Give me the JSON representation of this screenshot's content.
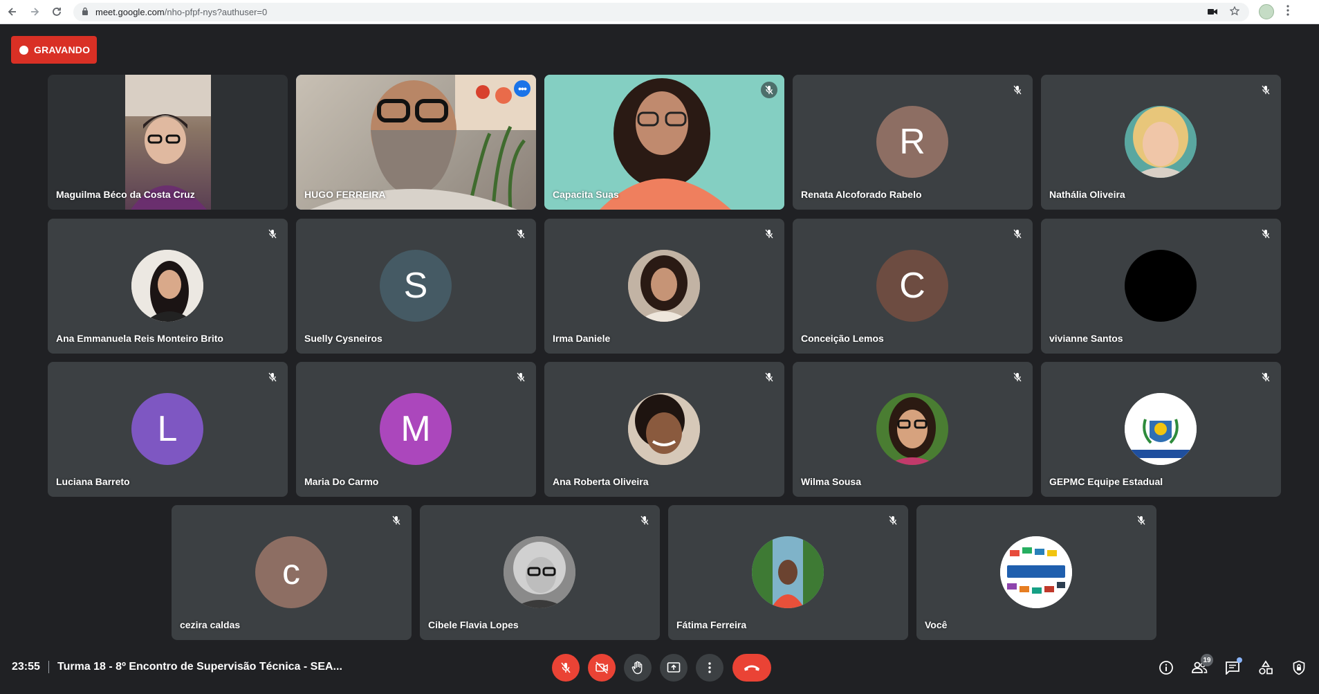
{
  "browser": {
    "url_host": "meet.google.com",
    "url_path": "/nho-pfpf-nys?authuser=0"
  },
  "recording": {
    "label": "GRAVANDO",
    "color": "#d93025"
  },
  "participants": [
    {
      "name": "Maguilma Béco da Costa Cruz",
      "type": "video"
    },
    {
      "name": "HUGO FERREIRA",
      "type": "video",
      "speaking": true
    },
    {
      "name": "Capacita Suas",
      "type": "video",
      "muted": true
    },
    {
      "name": "Renata Alcoforado Rabelo",
      "type": "initial",
      "initial": "R",
      "color": "#8d6e63",
      "muted": true
    },
    {
      "name": "Nathália Oliveira",
      "type": "photo",
      "muted": true
    },
    {
      "name": "Ana Emmanuela Reis Monteiro Brito",
      "type": "photo",
      "muted": true
    },
    {
      "name": "Suelly Cysneiros",
      "type": "initial",
      "initial": "S",
      "color": "#455a64",
      "muted": true
    },
    {
      "name": "Irma Daniele",
      "type": "photo",
      "muted": true
    },
    {
      "name": "Conceição Lemos",
      "type": "initial",
      "initial": "C",
      "color": "#6d4c41",
      "muted": true
    },
    {
      "name": "vivianne Santos",
      "type": "photo",
      "muted": true
    },
    {
      "name": "Luciana Barreto",
      "type": "initial",
      "initial": "L",
      "color": "#7e57c2",
      "muted": true
    },
    {
      "name": "Maria Do Carmo",
      "type": "initial",
      "initial": "M",
      "color": "#ab47bc",
      "muted": true
    },
    {
      "name": "Ana Roberta Oliveira",
      "type": "photo",
      "muted": true
    },
    {
      "name": "Wilma Sousa",
      "type": "photo",
      "muted": true
    },
    {
      "name": "GEPMC Equipe Estadual",
      "type": "photo",
      "muted": true
    },
    {
      "name": "cezira caldas",
      "type": "initial",
      "initial": "c",
      "color": "#8d6e63",
      "muted": true
    },
    {
      "name": "Cibele Flavia Lopes",
      "type": "photo",
      "muted": true
    },
    {
      "name": "Fátima Ferreira",
      "type": "photo",
      "muted": true
    },
    {
      "name": "Você",
      "type": "photo",
      "muted": true
    }
  ],
  "meeting": {
    "time": "23:55",
    "title": "Turma 18 - 8º Encontro de Supervisão Técnica - SEA...",
    "people_count": "19"
  },
  "colors": {
    "background": "#202124",
    "tile": "#3c4043",
    "accent": "#8ab4f8",
    "danger": "#ea4335"
  },
  "icons": [
    "back-icon",
    "forward-icon",
    "reload-icon",
    "lock-icon",
    "camera-icon",
    "star-icon",
    "menu-icon",
    "mic-off-icon",
    "camera-off-icon",
    "raise-hand-icon",
    "present-icon",
    "more-options-icon",
    "hang-up-icon",
    "info-icon",
    "people-icon",
    "chat-icon",
    "activities-icon",
    "host-controls-icon"
  ]
}
